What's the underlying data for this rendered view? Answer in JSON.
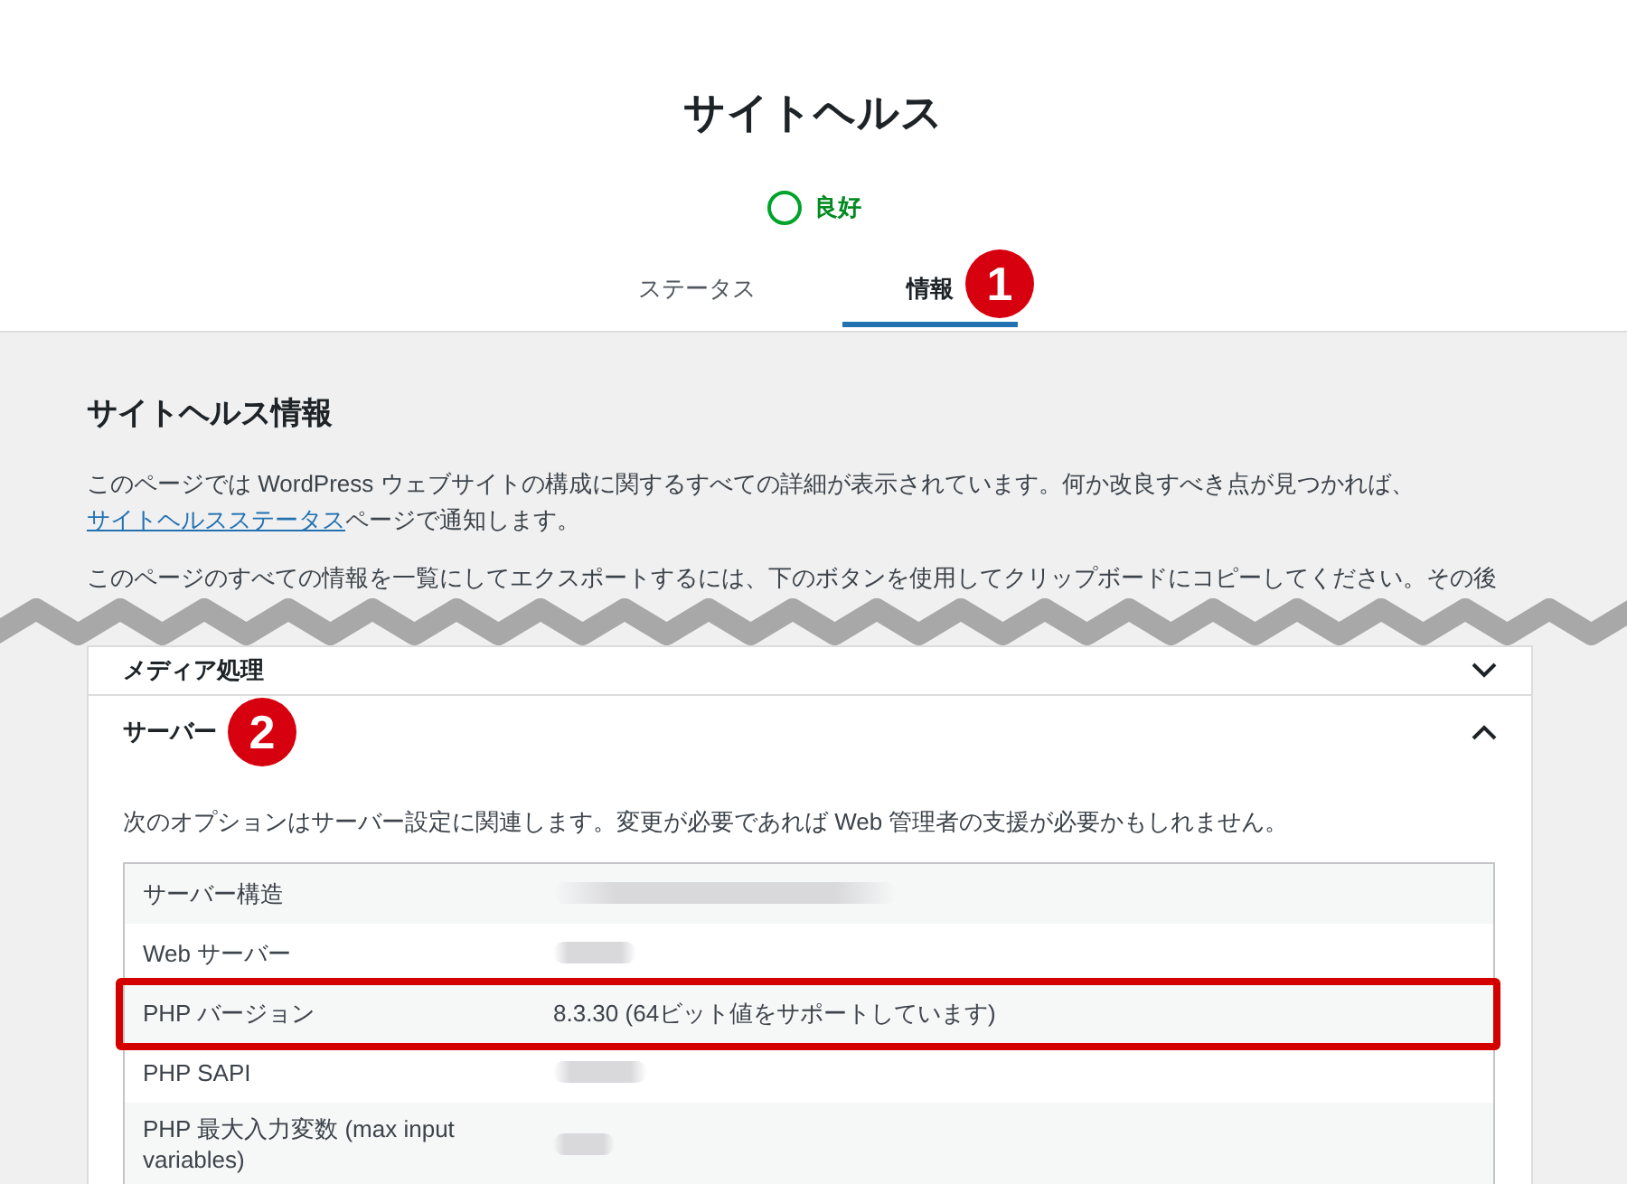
{
  "header": {
    "title": "サイトヘルス",
    "status": {
      "kind": "good",
      "label": "良好"
    },
    "tabs": [
      {
        "label": "ステータス",
        "selected": false
      },
      {
        "label": "情報",
        "selected": true,
        "callout": "1"
      }
    ]
  },
  "info": {
    "heading": "サイトヘルス情報",
    "intro": {
      "text": "このページでは WordPress ウェブサイトの構成に関するすべての詳細が表示されています。何か改良すべき点が見つかれば、",
      "link": "サイトヘルスステータス",
      "after": "ページで通知します。"
    },
    "export_note": "このページのすべての情報を一覧にしてエクスポートするには、下のボタンを使用してクリップボードにコピーしてください。その後"
  },
  "sections": [
    {
      "title": "メディア処理",
      "expanded": false
    },
    {
      "title": "サーバー",
      "expanded": true,
      "callout": "2",
      "description": "次のオプションはサーバー設定に関連します。変更が必要であれば Web 管理者の支援が必要かもしれません。",
      "rows": [
        {
          "label": "サーバー構造",
          "redacted": true,
          "highlighted": false
        },
        {
          "label": "Web サーバー",
          "redacted": true,
          "highlighted": false
        },
        {
          "label": "PHP バージョン",
          "value": "8.3.30 (64ビット値をサポートしています)",
          "redacted": false,
          "highlighted": true
        },
        {
          "label": "PHP SAPI",
          "redacted": true,
          "highlighted": false
        },
        {
          "label": "PHP 最大入力変数 (max input variables)",
          "redacted": true,
          "highlighted": false
        }
      ]
    }
  ]
}
